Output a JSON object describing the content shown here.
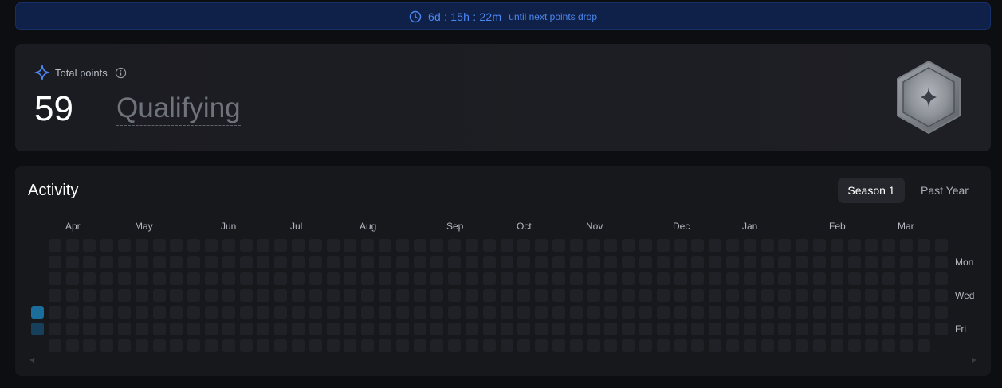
{
  "banner": {
    "timer": "6d : 15h : 22m",
    "suffix": "until next points drop",
    "icon": "clock-icon",
    "color": "#4c86f0"
  },
  "points": {
    "label": "Total points",
    "value": "59",
    "status": "Qualifying",
    "icons": [
      "sparkle-icon",
      "info-icon",
      "rank-badge-icon"
    ]
  },
  "activity": {
    "title": "Activity",
    "tabs": [
      {
        "label": "Season 1",
        "selected": true
      },
      {
        "label": "Past Year",
        "selected": false
      }
    ],
    "months": [
      "Apr",
      "May",
      "Jun",
      "Jul",
      "Aug",
      "Sep",
      "Oct",
      "Nov",
      "Dec",
      "Jan",
      "Feb",
      "Mar"
    ],
    "days": [
      "Mon",
      "Wed",
      "Fri"
    ],
    "active_days": [
      {
        "week": 0,
        "day": 4,
        "level": "high",
        "color": "#1b6e9c"
      },
      {
        "week": 0,
        "day": 5,
        "level": "low",
        "color": "#163f5c"
      }
    ],
    "empty_color": "#202126"
  }
}
